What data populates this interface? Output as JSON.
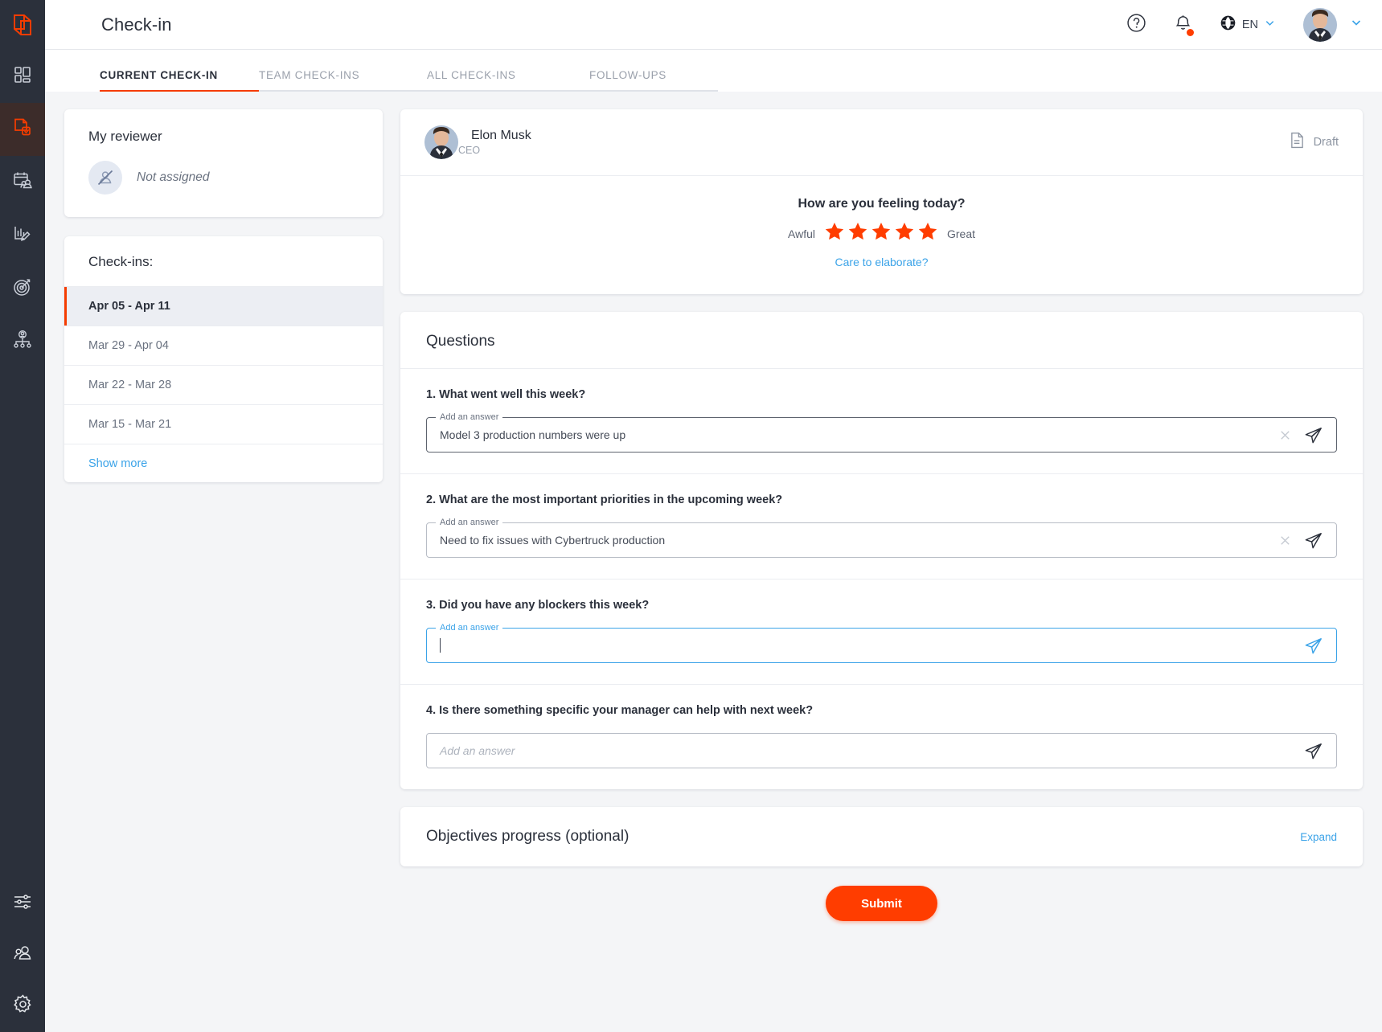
{
  "brand": {
    "accent": "#ff3d00",
    "accent_dark": "#f53c00",
    "link": "#3ba3e8",
    "rail_bg": "#2b303b"
  },
  "header": {
    "title": "Check-in",
    "help_icon": "question-circle-icon",
    "notifications_icon": "bell-icon",
    "language_icon": "globe-icon",
    "language": "EN",
    "language_chevron": "chevron-down-icon",
    "avatar_chevron": "chevron-down-icon"
  },
  "rail": {
    "logo": "app-logo-icon",
    "items": [
      {
        "name": "dashboard",
        "icon": "grid-icon",
        "active": false
      },
      {
        "name": "check-in",
        "icon": "document-check-icon",
        "active": true
      },
      {
        "name": "meetings",
        "icon": "calendar-people-icon",
        "active": false
      },
      {
        "name": "reviews",
        "icon": "chart-pencil-icon",
        "active": false
      },
      {
        "name": "objectives",
        "icon": "target-arrow-icon",
        "active": false
      },
      {
        "name": "org-chart",
        "icon": "org-chart-icon",
        "active": false
      }
    ],
    "bottom_items": [
      {
        "name": "settings-sliders",
        "icon": "sliders-icon"
      },
      {
        "name": "people",
        "icon": "people-icon"
      },
      {
        "name": "admin-settings",
        "icon": "gear-icon"
      }
    ]
  },
  "tabs": [
    {
      "label": "CURRENT CHECK-IN",
      "active": true
    },
    {
      "label": "TEAM CHECK-INS",
      "active": false
    },
    {
      "label": "ALL CHECK-INS",
      "active": false
    },
    {
      "label": "FOLLOW-UPS",
      "active": false
    }
  ],
  "reviewer": {
    "title": "My reviewer",
    "avatar_icon": "person-slash-icon",
    "status": "Not assigned"
  },
  "checkins": {
    "title": "Check-ins:",
    "items": [
      {
        "label": "Apr 05 - Apr 11",
        "active": true
      },
      {
        "label": "Mar 29 - Apr 04",
        "active": false
      },
      {
        "label": "Mar 22 - Mar 28",
        "active": false
      },
      {
        "label": "Mar 15 - Mar 21",
        "active": false
      }
    ],
    "show_more": "Show more"
  },
  "mood": {
    "user_name": "Elon Musk",
    "user_role": "CEO",
    "status_icon": "document-icon",
    "status": "Draft",
    "question": "How are you feeling today?",
    "low_label": "Awful",
    "high_label": "Great",
    "stars_total": 5,
    "stars_selected": 5,
    "elaborate_link": "Care to elaborate?"
  },
  "questions": {
    "heading": "Questions",
    "items": [
      {
        "label": "1. What went well this week?",
        "field_legend": "Add an answer",
        "value": "Model 3 production numbers were up",
        "placeholder": "",
        "state": "filled",
        "has_clear": true,
        "send_icon": "send-paper-plane-icon",
        "clear_icon": "close-x-icon"
      },
      {
        "label": "2. What are the most important priorities in the upcoming week?",
        "field_legend": "Add an answer",
        "value": "Need to fix issues with Cybertruck production",
        "placeholder": "",
        "state": "filled",
        "has_clear": true,
        "send_icon": "send-paper-plane-icon",
        "clear_icon": "close-x-icon"
      },
      {
        "label": "3. Did you have any blockers this week?",
        "field_legend": "Add an answer",
        "value": "",
        "placeholder": "",
        "state": "focused",
        "has_clear": false,
        "send_icon": "send-paper-plane-icon",
        "clear_icon": ""
      },
      {
        "label": "4. Is there something specific your manager can help with next week?",
        "field_legend": "",
        "value": "",
        "placeholder": "Add an answer",
        "state": "empty",
        "has_clear": false,
        "send_icon": "send-paper-plane-icon",
        "clear_icon": ""
      }
    ]
  },
  "objectives": {
    "title": "Objectives progress (optional)",
    "expand": "Expand"
  },
  "submit": {
    "label": "Submit"
  }
}
